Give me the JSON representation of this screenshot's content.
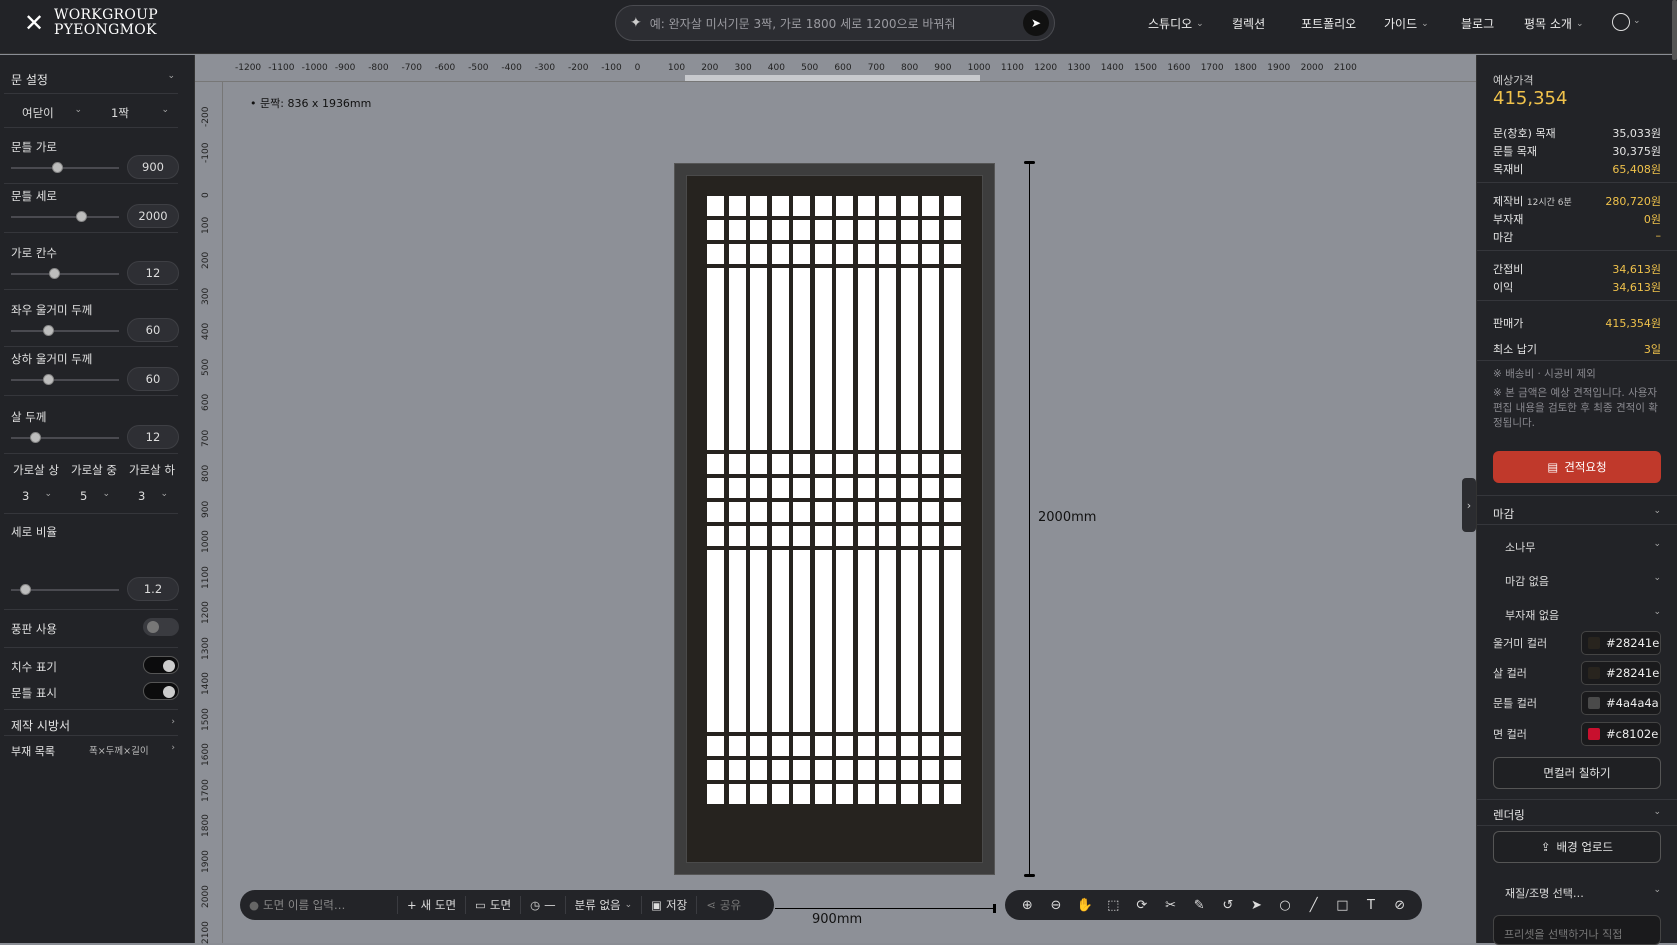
{
  "header": {
    "logo_line1": "WORKGROUP",
    "logo_line2": "PYEONGMOK",
    "search_placeholder": "예: 완자살 미서기문 3짝, 가로 1800 세로 1200으로 바꿔줘",
    "nav": [
      "스튜디오",
      "컬렉션",
      "포트폴리오",
      "가이드",
      "블로그",
      "평목 소개"
    ]
  },
  "left_panel": {
    "section_title": "문 설정",
    "door_type": "여닫이",
    "door_count": "1짝",
    "fields": [
      {
        "label": "문틀 가로",
        "value": "900",
        "level": 0.38
      },
      {
        "label": "문틀 세로",
        "value": "2000",
        "level": 0.6
      },
      {
        "label": "가로 칸수",
        "value": "12",
        "level": 0.35
      },
      {
        "label": "좌우 울거미 두께",
        "value": "60",
        "level": 0.3
      },
      {
        "label": "상하 울거미 두께",
        "value": "60",
        "level": 0.3
      },
      {
        "label": "살 두께",
        "value": "12",
        "level": 0.18
      }
    ],
    "crossbar_labels": [
      "가로살 상",
      "가로살 중",
      "가로살 하"
    ],
    "crossbar_values": [
      "3",
      "5",
      "3"
    ],
    "ratio": {
      "label": "세로 비율",
      "value": "1.2",
      "level": 0.08
    },
    "toggles": [
      {
        "label": "풍판 사용",
        "on": false
      },
      {
        "label": "치수 표기",
        "on": true
      },
      {
        "label": "문틀 표시",
        "on": true
      }
    ],
    "spec_label": "제작 시방서",
    "parts_label": "부재 목록",
    "parts_hint": "폭×두께×길이"
  },
  "canvas": {
    "door_info": "문짝: 836 x 1936mm",
    "height_label": "2000mm",
    "width_label": "900mm",
    "hruler_labels": [
      "-1200",
      "-1100",
      "-1000",
      "-900",
      "-800",
      "-700",
      "-600",
      "-500",
      "-400",
      "-300",
      "-200",
      "-100",
      "0",
      "100",
      "200",
      "300",
      "400",
      "500",
      "600",
      "700",
      "800",
      "900",
      "1000",
      "1100",
      "1200",
      "1300",
      "1400",
      "1500",
      "1600",
      "1700",
      "1800",
      "1900",
      "2000",
      "2100"
    ],
    "vruler_labels": [
      "-200",
      "-100",
      "0",
      "100",
      "200",
      "300",
      "400",
      "500",
      "600",
      "700",
      "800",
      "900",
      "1000",
      "1100",
      "1200",
      "1300",
      "1400",
      "1500",
      "1600",
      "1700",
      "1800",
      "1900",
      "2000",
      "2100"
    ],
    "bottom_bar": {
      "name_placeholder": "도면 이름 입력…",
      "new": "새 도면",
      "drawings": "도면",
      "history": "—",
      "category": "분류 없음",
      "save": "저장",
      "share": "공유"
    }
  },
  "right_panel": {
    "price_label": "예상가격",
    "price": "415,354",
    "rows_a": [
      {
        "k": "문(창호) 목재",
        "v": "35,033원",
        "yellow": false
      },
      {
        "k": "문틀 목재",
        "v": "30,375원",
        "yellow": false
      },
      {
        "k": "목재비",
        "v": "65,408원",
        "yellow": true
      }
    ],
    "rows_b": [
      {
        "k": "제작비",
        "sub": "12시간 6분",
        "v": "280,720원",
        "yellow": true
      },
      {
        "k": "부자재",
        "sub": "",
        "v": "0원",
        "yellow": true
      },
      {
        "k": "마감",
        "sub": "",
        "v": "–",
        "yellow": true
      }
    ],
    "rows_c": [
      {
        "k": "간접비",
        "v": "34,613원"
      },
      {
        "k": "이익",
        "v": "34,613원"
      }
    ],
    "sale_label": "판매가",
    "sale_value": "415,354원",
    "lead_label": "최소 납기",
    "lead_value": "3일",
    "note1": "※ 배송비 · 시공비 제외",
    "note2": "※ 본 금액은 예상 견적입니다. 사용자 편집 내용을 검토한 후 최종 견적이 확정됩니다.",
    "quote_button": "견적요청",
    "finish_title": "마감",
    "finish_wood": "소나무",
    "finish_coat": "마감 없음",
    "finish_parts": "부자재 없음",
    "colors": [
      {
        "label": "울거미 컬러",
        "hex": "#28241e"
      },
      {
        "label": "살 컬러",
        "hex": "#28241e"
      },
      {
        "label": "문틀 컬러",
        "hex": "#4a4a4a"
      },
      {
        "label": "면 컬러",
        "hex": "#c8102e"
      }
    ],
    "paint_button": "면컬러 칠하기",
    "render_title": "렌더링",
    "bg_upload": "배경 업로드",
    "material_select": "재질/조명 선택…",
    "preset_placeholder": "프리셋을 선택하거나 직접"
  }
}
